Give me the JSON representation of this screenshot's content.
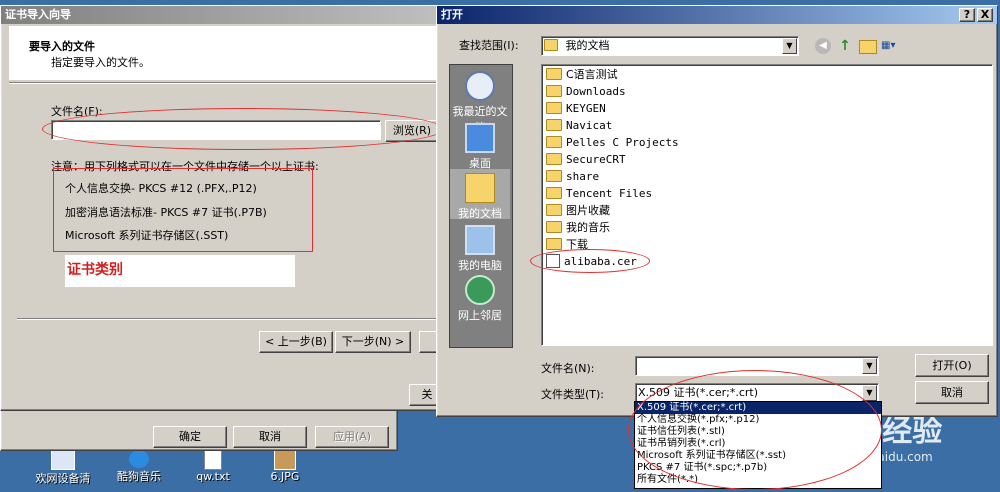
{
  "wizard": {
    "title": "证书导入向导",
    "heading": "要导入的文件",
    "subheading": "指定要导入的文件。",
    "file_label": "文件名(F):",
    "file_value": "",
    "browse_label": "浏览(R)",
    "note": "注意：用下列格式可以在一个文件中存储一个以上证书:",
    "formats": [
      "个人信息交换- PKCS #12 (.PFX,.P12)",
      "加密消息语法标准- PKCS #7 证书(.P7B)",
      "Microsoft 系列证书存储区(.SST)"
    ],
    "annotation": "证书类别",
    "back_label": "< 上一步(B)",
    "next_label": "下一步(N) >",
    "close_label": "关"
  },
  "parent_dialog": {
    "ok_label": "确定",
    "cancel_label": "取消",
    "apply_label": "应用(A)"
  },
  "open_dialog": {
    "title": "打开",
    "help_btn": "?",
    "close_btn": "X",
    "look_in_label": "查找范围(I):",
    "look_in_value": "我的文档",
    "places": [
      {
        "label": "我最近的文档",
        "icon": "recent-documents-icon"
      },
      {
        "label": "桌面",
        "icon": "desktop-icon"
      },
      {
        "label": "我的文档",
        "icon": "my-documents-icon"
      },
      {
        "label": "我的电脑",
        "icon": "my-computer-icon"
      },
      {
        "label": "网上邻居",
        "icon": "network-places-icon"
      }
    ],
    "files": [
      "C语言测试",
      "Downloads",
      "KEYGEN",
      "Navicat",
      "Pelles C Projects",
      "SecureCRT",
      "share",
      "Tencent Files",
      "图片收藏",
      "我的音乐",
      "下载",
      "alibaba.cer"
    ],
    "filename_label": "文件名(N):",
    "filename_value": "",
    "filetype_label": "文件类型(T):",
    "filetype_value": "X.509 证书(*.cer;*.crt)",
    "filetype_options": [
      "X.509 证书(*.cer;*.crt)",
      "个人信息交换(*.pfx;*.p12)",
      "证书信任列表(*.stl)",
      "证书吊销列表(*.crl)",
      "Microsoft 系列证书存储区(*.sst)",
      "PKCS #7 证书(*.spc;*.p7b)",
      "所有文件(*.*)"
    ],
    "open_label": "打开(O)",
    "cancel_label": "取消"
  },
  "desktop": {
    "icons": [
      "欢网设备清",
      "酷狗音乐",
      "qw.txt",
      "6.JPG"
    ],
    "watermark": "Baidu经验",
    "watermark_url": "jingyan.baidu.com"
  },
  "colors": {
    "selection": "#0a246a",
    "annotation_red": "#e03030",
    "dialog_gray": "#d4d0c8"
  }
}
